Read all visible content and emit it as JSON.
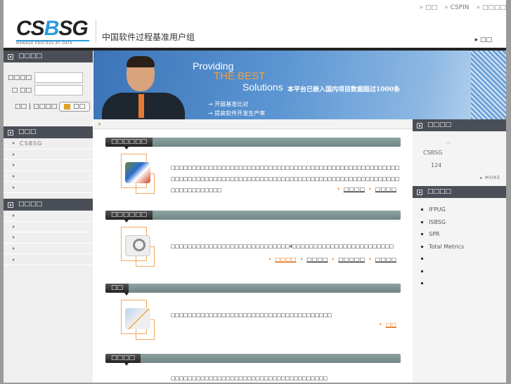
{
  "header": {
    "top_links": [
      {
        "label": "□□"
      },
      {
        "label": "CSPIN"
      },
      {
        "label": "□□□□"
      }
    ],
    "logo_text": "CSBSG",
    "logo_tagline": "MANAGE PROCESS BY DATA",
    "org_name": "中国软件过程基准用户组",
    "home_link": "□□"
  },
  "login": {
    "title": "□□□□",
    "username_label": "□□□□",
    "password_label": "□ □□",
    "username_value": "",
    "password_value": "",
    "register_link": "□□",
    "forgot_link": "□□□□",
    "login_button": "□□"
  },
  "left_menu_1": {
    "title": "□□□",
    "items": [
      "CSBSG",
      "",
      "",
      "",
      ""
    ]
  },
  "left_menu_2": {
    "title": "□□□□",
    "items": [
      "",
      "",
      "",
      "",
      ""
    ]
  },
  "banner": {
    "line1": "Providing",
    "line2": "THE BEST",
    "line3": "Solutions",
    "slogan": "本平台已嵌入国内项目数据超过1000条",
    "bullets": [
      "开展基准比对",
      "提高软件开发生产率"
    ]
  },
  "breadcrumb": "»",
  "sections": [
    {
      "title": "□□□□□□",
      "text": "□□□□□□□□□□□□□□□□□□□□□□□□□□□□□□□□□□□□□□□□□□□□□□□□□□□□□□□□□□□□□□□□□□□□□□□□□□□□□□□□□□□□□□□□□□□□□□□□□□□□□□□□□□□□□□□□□□□□□□□□",
      "links": [
        "□□□□",
        "□□□□"
      ],
      "icon": "database-report-icon"
    },
    {
      "title": "□□□□□□",
      "text": "□□□□□□□□□□□□□□□□□□□□□□□□□□□□4□□□□□□□□□□□□□□□□□□□□□□□□",
      "links": [
        "□□□□",
        "□□□□",
        "□□□□□",
        "□□□□"
      ],
      "icon": "magnifier-icon"
    },
    {
      "title": "□□",
      "text": "□□□□□□□□□□□□□□□□□□□□□□□□□□□□□□□□□□□□□□",
      "links": [
        "□□"
      ],
      "icon": "protractor-pencil-icon"
    },
    {
      "title": "□□□□",
      "text": "□□□□□□□□□□□□□□□□□□□□□□□□□□□□□□□□□□□□□",
      "links": [],
      "icon": "document-icon"
    }
  ],
  "right_news": {
    "title": "□□□□",
    "line1": "...",
    "line2": "CSBSG",
    "line3": "124",
    "more": "MORE"
  },
  "right_links": {
    "title": "□□□□",
    "items": [
      "IFPUG",
      "ISBSG",
      "SPR",
      "Total Metrics",
      "",
      "",
      ""
    ]
  },
  "colors": {
    "accent_blue": "#2b9be0",
    "header_dark": "#4a4f57",
    "link_orange": "#e06000"
  }
}
